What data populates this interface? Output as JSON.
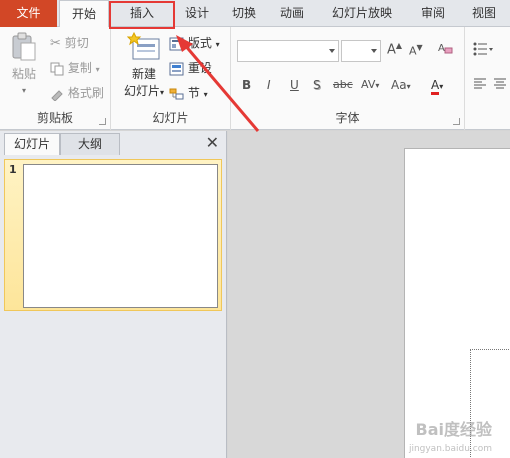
{
  "tabs": [
    {
      "label": "文件",
      "name": "tab-file"
    },
    {
      "label": "开始",
      "name": "tab-home"
    },
    {
      "label": "插入",
      "name": "tab-insert"
    },
    {
      "label": "设计",
      "name": "tab-design"
    },
    {
      "label": "切换",
      "name": "tab-transitions"
    },
    {
      "label": "动画",
      "name": "tab-animations"
    },
    {
      "label": "幻灯片放映",
      "name": "tab-slideshow"
    },
    {
      "label": "审阅",
      "name": "tab-review"
    },
    {
      "label": "视图",
      "name": "tab-view"
    }
  ],
  "ribbon": {
    "clipboard": {
      "label": "剪贴板",
      "paste": "粘贴",
      "cut": "剪切",
      "copy": "复制",
      "format_painter": "格式刷"
    },
    "slides": {
      "label": "幻灯片",
      "new_slide_line1": "新建",
      "new_slide_line2": "幻灯片",
      "layout": "版式",
      "reset": "重设",
      "section": "节"
    },
    "font": {
      "label": "字体",
      "bold": "B",
      "italic": "I",
      "underline": "U",
      "shadow": "S",
      "strike": "abc",
      "spacing": "AV",
      "case": "Aa",
      "color": "A",
      "grow": "A",
      "shrink": "A"
    }
  },
  "panel": {
    "tab_slides": "幻灯片",
    "tab_outline": "大纲",
    "close": "✕",
    "slide_number": "1"
  },
  "watermark": {
    "text": "Bai度经验",
    "sub": "jingyan.baidu.com"
  },
  "colors": {
    "file_tab": "#d24726",
    "highlight": "#e53935",
    "selected_thumb": "#fde59a"
  }
}
